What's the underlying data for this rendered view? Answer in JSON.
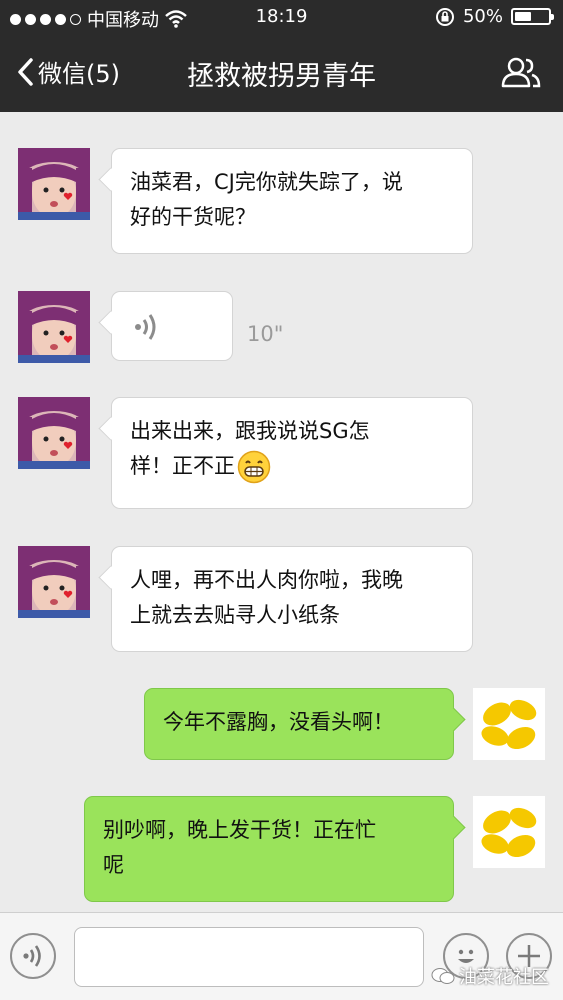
{
  "status_bar": {
    "carrier": "中国移动",
    "time": "18:19",
    "battery": "50%",
    "battery_level": 0.5
  },
  "nav": {
    "back_label": "微信(5)",
    "title": "拯救被拐男青年"
  },
  "messages": [
    {
      "side": "incoming",
      "type": "text",
      "text_line1": "油菜君，CJ完你就失踪了，说",
      "text_line2": "好的干货呢？"
    },
    {
      "side": "incoming",
      "type": "voice",
      "duration": "10\""
    },
    {
      "side": "incoming",
      "type": "text",
      "text_line1": "出来出来，跟我说说SG怎",
      "text_line2": "样！正不正",
      "emoji": "grin-emoji"
    },
    {
      "side": "incoming",
      "type": "text",
      "text_line1": "人哩，再不出人肉你啦，我晚",
      "text_line2": "上就去去贴寻人小纸条"
    },
    {
      "side": "outgoing",
      "type": "text",
      "text_line1": "今年不露胸，没看头啊！"
    },
    {
      "side": "outgoing",
      "type": "text",
      "text_line1": "别吵啊，晚上发干货！正在忙",
      "text_line2": "呢"
    }
  ],
  "input_bar": {
    "placeholder": ""
  },
  "watermark": "油菜花社区",
  "colors": {
    "nav_bg": "#2b2b2b",
    "chat_bg": "#ebebeb",
    "outgoing_bubble": "#9ae35b",
    "incoming_bubble": "#ffffff"
  }
}
